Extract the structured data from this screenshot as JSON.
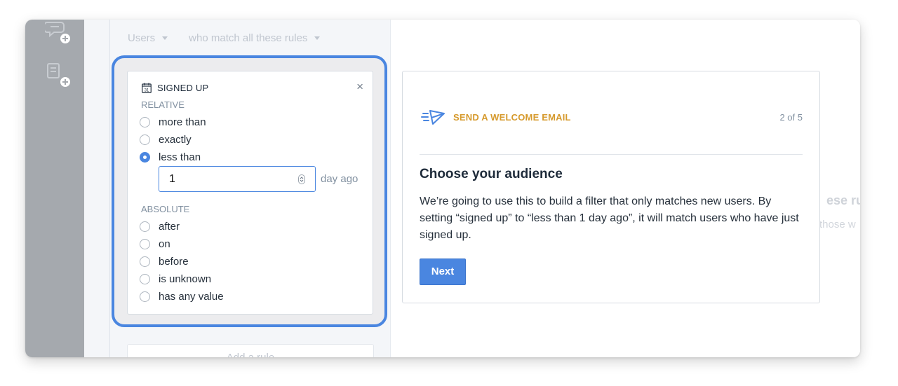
{
  "filters": {
    "audience_label": "Users",
    "match_label": "who match all these rules"
  },
  "rule_card": {
    "title": "SIGNED UP",
    "relative_label": "RELATIVE",
    "relative_options": [
      "more than",
      "exactly",
      "less than"
    ],
    "selected_option": "less than",
    "amount_value": "1",
    "amount_unit": "day ago",
    "absolute_label": "ABSOLUTE",
    "absolute_options": [
      "after",
      "on",
      "before",
      "is unknown",
      "has any value"
    ],
    "close_glyph": "×"
  },
  "add_rule_label": "Add a rule",
  "background_text": {
    "line1": "ese rul",
    "line2": "those w"
  },
  "tour": {
    "title": "SEND A WELCOME EMAIL",
    "step": "2 of 5",
    "heading": "Choose your audience",
    "body": "We’re going to use this to build a filter that only matches new users. By setting “signed up” to “less than 1 day ago”, it will match users who have just signed up.",
    "next_label": "Next"
  },
  "icons": {
    "calendar": "calendar-icon",
    "send": "paper-plane-icon",
    "close": "close-icon",
    "stepper": "stepper-icon"
  },
  "colors": {
    "accent": "#4a86e0",
    "tour_title": "#d69a2d",
    "rail": "#a5a9ae"
  }
}
